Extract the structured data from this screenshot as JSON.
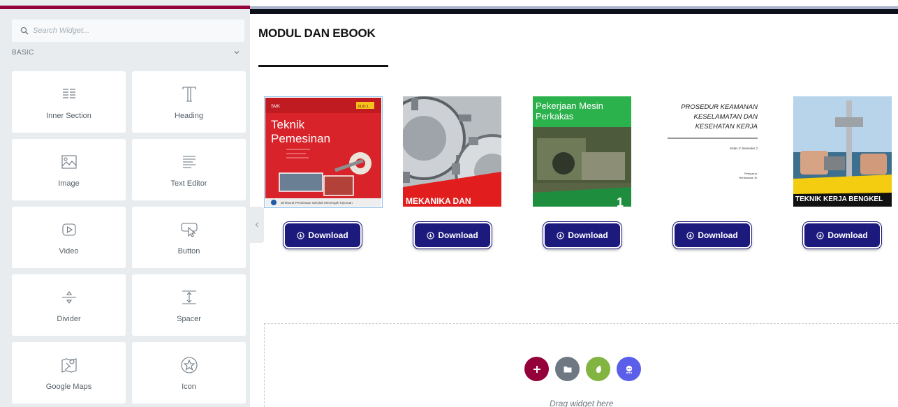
{
  "sidebar": {
    "search": {
      "placeholder": "Search Widget..."
    },
    "category": {
      "label": "BASIC"
    },
    "widgets": [
      {
        "label": "Inner Section",
        "icon": "inner-section-icon"
      },
      {
        "label": "Heading",
        "icon": "heading-icon"
      },
      {
        "label": "Image",
        "icon": "image-icon"
      },
      {
        "label": "Text Editor",
        "icon": "text-editor-icon"
      },
      {
        "label": "Video",
        "icon": "video-icon"
      },
      {
        "label": "Button",
        "icon": "button-icon"
      },
      {
        "label": "Divider",
        "icon": "divider-icon"
      },
      {
        "label": "Spacer",
        "icon": "spacer-icon"
      },
      {
        "label": "Google Maps",
        "icon": "google-maps-icon"
      },
      {
        "label": "Icon",
        "icon": "star-icon"
      }
    ],
    "accent_color": "#93003a"
  },
  "main": {
    "title": "MODUL DAN EBOOK",
    "books": [
      {
        "series": "SMK",
        "badge": "JILID 1",
        "title_line1": "Teknik",
        "title_line2": "Pemesinan",
        "footer": "Direktorat Pembinaan Sekolah Menengah Kejuruan"
      },
      {
        "title": "MEKANIKA DAN"
      },
      {
        "title_line1": "Pekerjaan Mesin",
        "title_line2": "Perkakas",
        "number": "1"
      },
      {
        "title_line1": "PROSEDUR KEAMANAN",
        "title_line2": "KESELAMATAN DAN",
        "title_line3": "KESEHATAN KERJA",
        "class": "Kelas X Semester 2",
        "author_label": "Penyusun:",
        "author": "Herliwanda, M."
      },
      {
        "title": "TEKNIK KERJA BENGKEL"
      }
    ],
    "download_label": "Download",
    "button_color": "#1d1a7d",
    "drop_zone": {
      "hint": "Drag widget here",
      "actions": [
        {
          "icon": "plus-icon",
          "color": "#93003a"
        },
        {
          "icon": "folder-icon",
          "color": "#6d7882"
        },
        {
          "icon": "envato-icon",
          "color": "#81b441"
        },
        {
          "icon": "ai-icon",
          "color": "#5a5ee8"
        }
      ]
    }
  }
}
